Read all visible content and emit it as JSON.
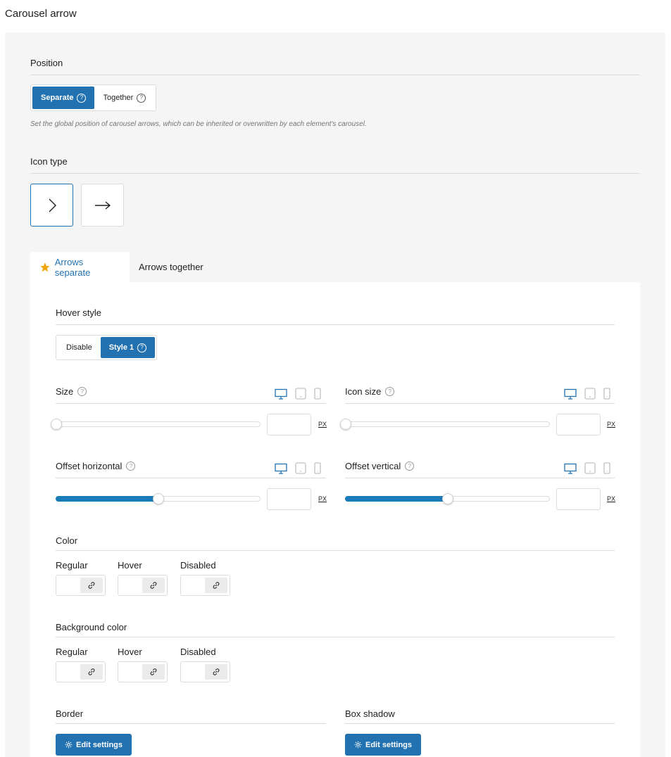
{
  "page_title": "Carousel arrow",
  "position": {
    "label": "Position",
    "options": [
      {
        "label": "Separate",
        "active": true
      },
      {
        "label": "Together",
        "active": false
      }
    ],
    "description": "Set the global position of carousel arrows, which can be inherited or overwritten by each element's carousel."
  },
  "icon_type": {
    "label": "Icon type",
    "options": [
      {
        "name": "chevron-right-icon",
        "selected": true
      },
      {
        "name": "arrow-right-icon",
        "selected": false
      }
    ]
  },
  "tabs": [
    {
      "label": "Arrows separate",
      "active": true,
      "icon": "star-icon"
    },
    {
      "label": "Arrows together",
      "active": false
    }
  ],
  "hover_style": {
    "label": "Hover style",
    "options": [
      {
        "label": "Disable",
        "active": false
      },
      {
        "label": "Style 1",
        "active": true
      }
    ]
  },
  "sliders": {
    "size": {
      "label": "Size",
      "value": 0,
      "unit": "PX"
    },
    "icon_size": {
      "label": "Icon size",
      "value": 0,
      "unit": "PX"
    },
    "offset_horizontal": {
      "label": "Offset horizontal",
      "value": 0.5,
      "unit": "PX"
    },
    "offset_vertical": {
      "label": "Offset vertical",
      "value": 0.5,
      "unit": "PX"
    }
  },
  "color": {
    "label": "Color",
    "states": [
      "Regular",
      "Hover",
      "Disabled"
    ]
  },
  "background_color": {
    "label": "Background color",
    "states": [
      "Regular",
      "Hover",
      "Disabled"
    ]
  },
  "border": {
    "label": "Border",
    "button": "Edit settings"
  },
  "box_shadow": {
    "label": "Box shadow",
    "button": "Edit settings"
  },
  "colors": {
    "accent": "#2271b1",
    "slider_fill": "#1a7bb9",
    "star": "#f0a30a"
  }
}
